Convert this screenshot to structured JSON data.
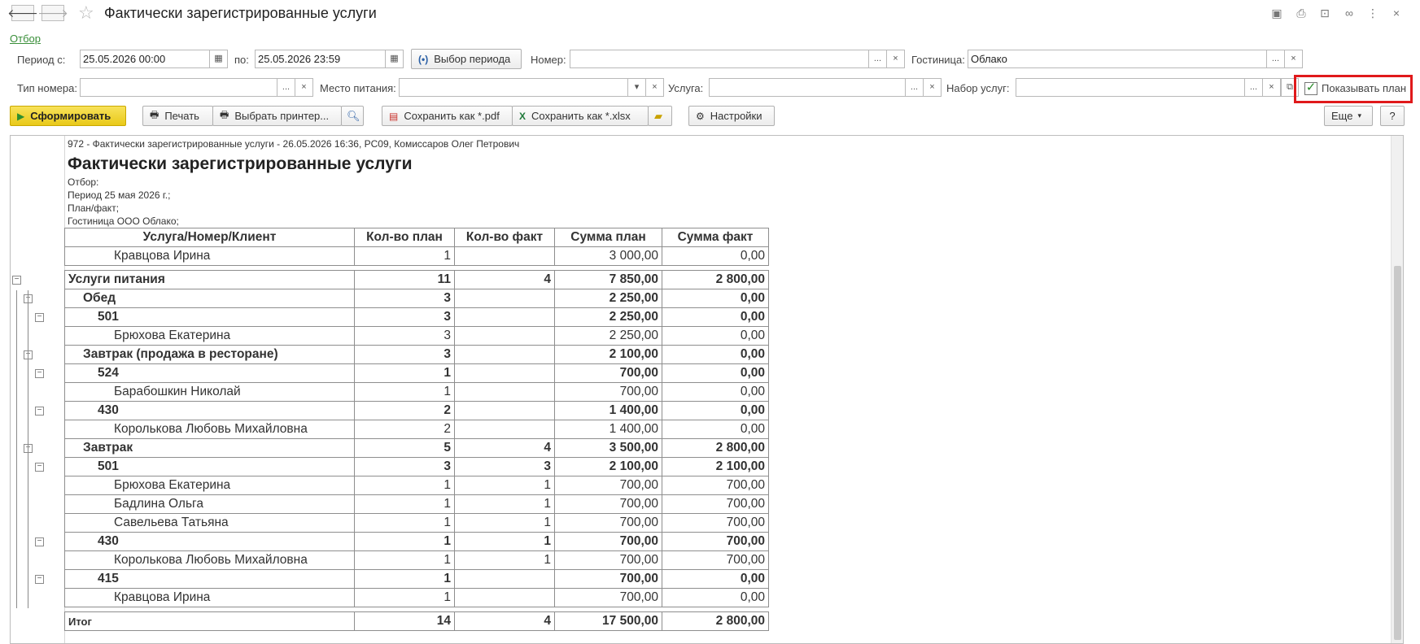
{
  "window": {
    "title": "Фактически зарегистрированные услуги",
    "back_icon": "arrow-left-icon",
    "forward_icon": "arrow-right-icon"
  },
  "filter_link": "Отбор",
  "form": {
    "period_from_label": "Период с:",
    "period_from": "25.05.2026 00:00",
    "period_to_label": "по:",
    "period_to": "25.05.2026 23:59",
    "period_button": "Выбор периода",
    "number_label": "Номер:",
    "number": "",
    "hotel_label": "Гостиница:",
    "hotel": "Облако",
    "room_type_label": "Тип номера:",
    "room_type": "",
    "meal_place_label": "Место питания:",
    "meal_place": "",
    "service_label": "Услуга:",
    "service": "",
    "service_set_label": "Набор услуг:",
    "service_set": "",
    "show_plan_label": "Показывать план",
    "show_plan_checked": true
  },
  "toolbar": {
    "generate": "Сформировать",
    "print": "Печать",
    "choose_printer": "Выбрать принтер...",
    "save_pdf": "Сохранить как *.pdf",
    "save_xlsx": "Сохранить как *.xlsx",
    "settings": "Настройки",
    "more": "Еще",
    "help": "?"
  },
  "report": {
    "meta": "972 - Фактически зарегистрированные услуги - 26.05.2026 16:36, PC09, Комиссаров Олег Петрович",
    "title": "Фактически зарегистрированные услуги",
    "filter_caption": "Отбор:",
    "filter_lines": [
      "Период 25 мая 2026 г.;",
      "План/факт;",
      "Гостиница ООО Облако;"
    ],
    "columns": [
      "Услуга/Номер/Клиент",
      "Кол-во план",
      "Кол-во факт",
      "Сумма план",
      "Сумма факт"
    ],
    "carry_row": [
      "Кравцова Ирина",
      "1",
      "",
      "3 000,00",
      "0,00"
    ],
    "rows": [
      {
        "name": "Услуги питания",
        "level": 0,
        "bold": true,
        "qty_plan": "11",
        "qty_fact": "4",
        "sum_plan": "7 850,00",
        "sum_fact": "2 800,00"
      },
      {
        "name": "Обед",
        "level": 1,
        "bold": true,
        "qty_plan": "3",
        "qty_fact": "",
        "sum_plan": "2 250,00",
        "sum_fact": "0,00"
      },
      {
        "name": "501",
        "level": 2,
        "bold": true,
        "qty_plan": "3",
        "qty_fact": "",
        "sum_plan": "2 250,00",
        "sum_fact": "0,00"
      },
      {
        "name": "Брюхова Екатерина",
        "level": 3,
        "bold": false,
        "qty_plan": "3",
        "qty_fact": "",
        "sum_plan": "2 250,00",
        "sum_fact": "0,00"
      },
      {
        "name": "Завтрак (продажа в ресторане)",
        "level": 1,
        "bold": true,
        "qty_plan": "3",
        "qty_fact": "",
        "sum_plan": "2 100,00",
        "sum_fact": "0,00"
      },
      {
        "name": "524",
        "level": 2,
        "bold": true,
        "qty_plan": "1",
        "qty_fact": "",
        "sum_plan": "700,00",
        "sum_fact": "0,00"
      },
      {
        "name": "Барабошкин Николай",
        "level": 3,
        "bold": false,
        "qty_plan": "1",
        "qty_fact": "",
        "sum_plan": "700,00",
        "sum_fact": "0,00"
      },
      {
        "name": "430",
        "level": 2,
        "bold": true,
        "qty_plan": "2",
        "qty_fact": "",
        "sum_plan": "1 400,00",
        "sum_fact": "0,00"
      },
      {
        "name": "Королькова Любовь Михайловна",
        "level": 3,
        "bold": false,
        "qty_plan": "2",
        "qty_fact": "",
        "sum_plan": "1 400,00",
        "sum_fact": "0,00"
      },
      {
        "name": "Завтрак",
        "level": 1,
        "bold": true,
        "qty_plan": "5",
        "qty_fact": "4",
        "sum_plan": "3 500,00",
        "sum_fact": "2 800,00"
      },
      {
        "name": "501",
        "level": 2,
        "bold": true,
        "qty_plan": "3",
        "qty_fact": "3",
        "sum_plan": "2 100,00",
        "sum_fact": "2 100,00"
      },
      {
        "name": "Брюхова Екатерина",
        "level": 3,
        "bold": false,
        "qty_plan": "1",
        "qty_fact": "1",
        "sum_plan": "700,00",
        "sum_fact": "700,00"
      },
      {
        "name": "Бадлина Ольга",
        "level": 3,
        "bold": false,
        "qty_plan": "1",
        "qty_fact": "1",
        "sum_plan": "700,00",
        "sum_fact": "700,00"
      },
      {
        "name": "Савельева Татьяна",
        "level": 3,
        "bold": false,
        "qty_plan": "1",
        "qty_fact": "1",
        "sum_plan": "700,00",
        "sum_fact": "700,00"
      },
      {
        "name": "430",
        "level": 2,
        "bold": true,
        "qty_plan": "1",
        "qty_fact": "1",
        "sum_plan": "700,00",
        "sum_fact": "700,00"
      },
      {
        "name": "Королькова Любовь Михайловна",
        "level": 3,
        "bold": false,
        "qty_plan": "1",
        "qty_fact": "1",
        "sum_plan": "700,00",
        "sum_fact": "700,00"
      },
      {
        "name": "415",
        "level": 2,
        "bold": true,
        "qty_plan": "1",
        "qty_fact": "",
        "sum_plan": "700,00",
        "sum_fact": "0,00"
      },
      {
        "name": "Кравцова Ирина",
        "level": 3,
        "bold": false,
        "qty_plan": "1",
        "qty_fact": "",
        "sum_plan": "700,00",
        "sum_fact": "0,00"
      }
    ],
    "total": {
      "name": "Итог",
      "qty_plan": "14",
      "qty_fact": "4",
      "sum_plan": "17 500,00",
      "sum_fact": "2 800,00"
    }
  },
  "colors": {
    "accent_yellow": "#f0d232",
    "highlight_red": "#e0191b",
    "link_green": "#3a8f3a"
  }
}
